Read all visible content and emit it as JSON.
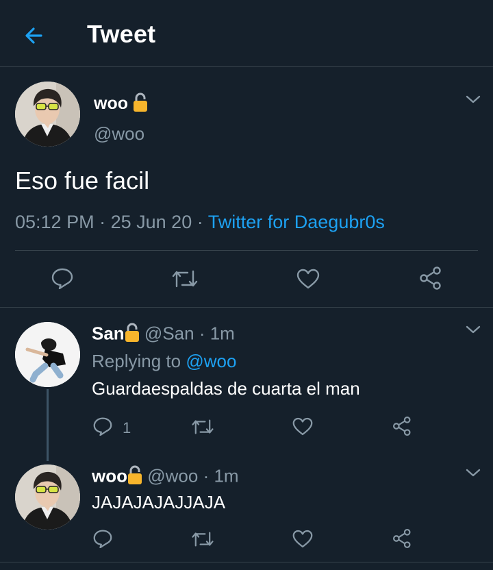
{
  "header": {
    "title": "Tweet",
    "back_icon": "arrow-left-icon"
  },
  "colors": {
    "background": "#15202b",
    "accent": "#1da1f2",
    "muted": "#8899a6",
    "divider": "#38444d",
    "lock": "#f7b52c"
  },
  "main_tweet": {
    "display_name": "woo",
    "handle": "@woo",
    "text": "Eso fue facil",
    "time": "05:12 PM",
    "separator": "·",
    "date": "25 Jun 20",
    "client": "Twitter for Daegubr0s",
    "actions": [
      "reply-icon",
      "retweet-icon",
      "like-icon",
      "share-icon"
    ]
  },
  "replies": [
    {
      "display_name": "San",
      "handle": "@San",
      "time": "· 1m",
      "replying_label": "Replying to",
      "replying_to": "@woo",
      "text": "Guardaespaldas de cuarta el man",
      "reply_count": "1"
    },
    {
      "display_name": "woo",
      "handle": "@woo",
      "time": "· 1m",
      "text": "JAJAJAJAJJAJA",
      "reply_count": ""
    }
  ]
}
